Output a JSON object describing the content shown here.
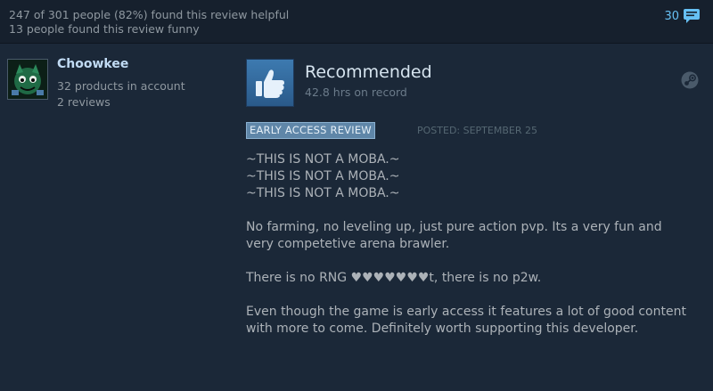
{
  "votes": {
    "helpful_text": "247 of 301 people (82%) found this review helpful",
    "funny_text": "13 people found this review funny",
    "comment_count": "30"
  },
  "author": {
    "name": "Choowkee",
    "products": "32 products in account",
    "reviews": "2 reviews"
  },
  "review": {
    "verdict": "Recommended",
    "hours": "42.8 hrs on record",
    "badge": "EARLY ACCESS REVIEW",
    "posted": "POSTED: SEPTEMBER 25",
    "paragraphs": [
      "~THIS IS NOT A MOBA.~\n~THIS IS NOT A MOBA.~\n~THIS IS NOT A MOBA.~",
      "No farming, no leveling up, just pure action pvp. Its a very fun and very competetive arena brawler.",
      "There is no RNG ♥♥♥♥♥♥♥t, there is no p2w.",
      "Even though the game is early access it features a lot of good content with more to come. Definitely worth supporting this developer."
    ]
  },
  "icons": {
    "comment": "speech-bubble-icon",
    "thumb": "thumbs-up-icon",
    "platform": "steam-logo-icon"
  },
  "colors": {
    "background": "#1b2838",
    "top_bar": "#16202d",
    "link_blue": "#66c0f4",
    "badge_bg": "#5f86a8",
    "body_text": "#acb2b8"
  }
}
